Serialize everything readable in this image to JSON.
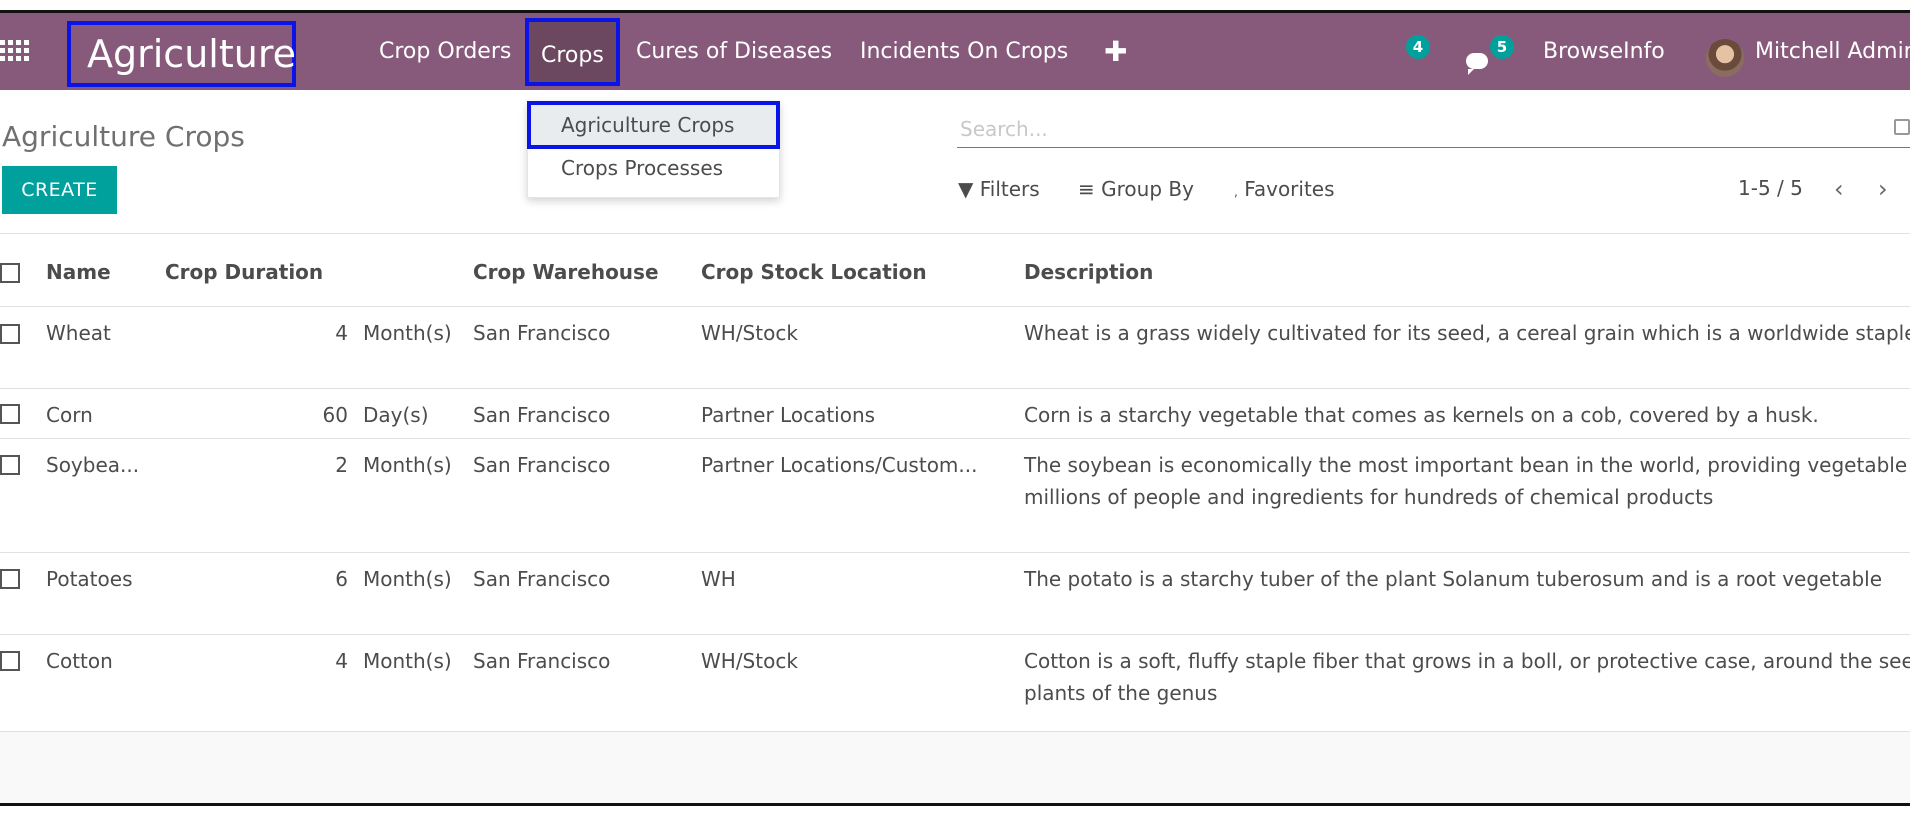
{
  "navbar": {
    "app_name": "Agriculture",
    "menu": [
      "Crop Orders",
      "Crops",
      "Cures of Diseases",
      "Incidents On Crops"
    ],
    "plus": "✚",
    "activity_count": "4",
    "message_count": "5",
    "company": "BrowseInfo",
    "user": "Mitchell Admin",
    "accent": "#875a7b"
  },
  "dropdown": {
    "items": [
      "Agriculture Crops",
      "Crops Processes"
    ]
  },
  "control": {
    "title": "Agriculture Crops",
    "create_label": "CREATE",
    "search_placeholder": "Search...",
    "filters_label": "Filters",
    "groupby_label": "Group By",
    "favorites_label": "Favorites",
    "pager": "1-5 / 5"
  },
  "table": {
    "headers": [
      "Name",
      "Crop Duration",
      "Crop Warehouse",
      "Crop Stock Location",
      "Description"
    ],
    "rows": [
      {
        "name": "Wheat",
        "dur": "4",
        "unit": "Month(s)",
        "warehouse": "San Francisco",
        "location": "WH/Stock",
        "desc": "Wheat is a grass widely cultivated for its seed, a cereal grain which is a worldwide staple food."
      },
      {
        "name": "Corn",
        "dur": "60",
        "unit": "Day(s)",
        "warehouse": "San Francisco",
        "location": "Partner Locations",
        "desc": "Corn is a starchy vegetable that comes as kernels on a cob, covered by a husk."
      },
      {
        "name": "Soybea...",
        "dur": "2",
        "unit": "Month(s)",
        "warehouse": "San Francisco",
        "location": "Partner Locations/Custom...",
        "desc": "The soybean is economically the most important bean in the world, providing vegetable protein for millions of people and ingredients for hundreds of chemical products"
      },
      {
        "name": "Potatoes",
        "dur": "6",
        "unit": "Month(s)",
        "warehouse": "San Francisco",
        "location": "WH",
        "desc": "The potato is a starchy tuber of the plant Solanum tuberosum and is a root vegetable"
      },
      {
        "name": "Cotton",
        "dur": "4",
        "unit": "Month(s)",
        "warehouse": "San Francisco",
        "location": "WH/Stock",
        "desc": "Cotton is a soft, fluffy staple fiber that grows in a boll, or protective case, around the seeds of the cotton plants of the genus"
      }
    ]
  }
}
